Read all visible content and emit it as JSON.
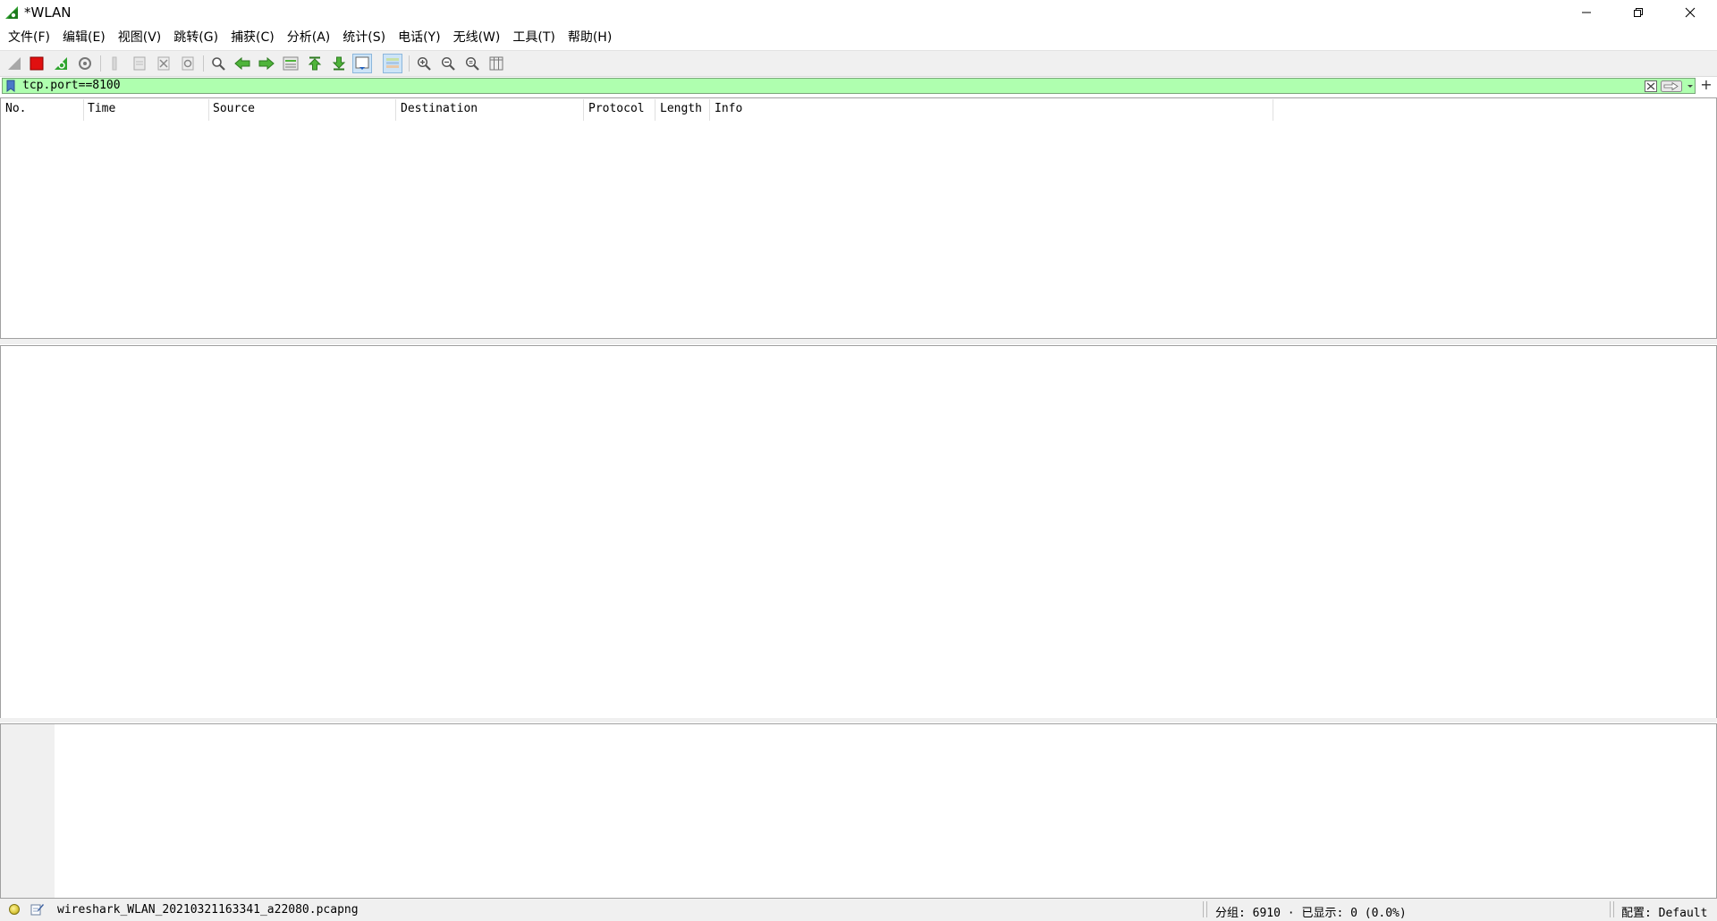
{
  "window": {
    "title": "*WLAN"
  },
  "menubar": {
    "items": [
      "文件(F)",
      "编辑(E)",
      "视图(V)",
      "跳转(G)",
      "捕获(C)",
      "分析(A)",
      "统计(S)",
      "电话(Y)",
      "无线(W)",
      "工具(T)",
      "帮助(H)"
    ]
  },
  "toolbar": {
    "icons": [
      "start-capture-icon",
      "stop-capture-icon",
      "restart-capture-icon",
      "capture-options-icon",
      "open-file-icon",
      "save-file-icon",
      "close-file-icon",
      "reload-file-icon",
      "find-packet-icon",
      "go-back-icon",
      "go-forward-icon",
      "go-to-packet-icon",
      "go-first-packet-icon",
      "go-last-packet-icon",
      "auto-scroll-icon",
      "colorize-icon",
      "zoom-in-icon",
      "zoom-out-icon",
      "normal-size-icon",
      "resize-columns-icon"
    ]
  },
  "filter": {
    "value": "tcp.port==8100"
  },
  "packet_list": {
    "columns": [
      "No.",
      "Time",
      "Source",
      "Destination",
      "Protocol",
      "Length",
      "Info"
    ]
  },
  "statusbar": {
    "file": "wireshark_WLAN_20210321163341_a22080.pcapng",
    "packets": "分组: 6910 · 已显示: 0 (0.0%)",
    "profile": "配置: Default"
  },
  "colors": {
    "filter_valid_bg": "#afffaf",
    "toolbar_bg": "#f0f0f0"
  }
}
